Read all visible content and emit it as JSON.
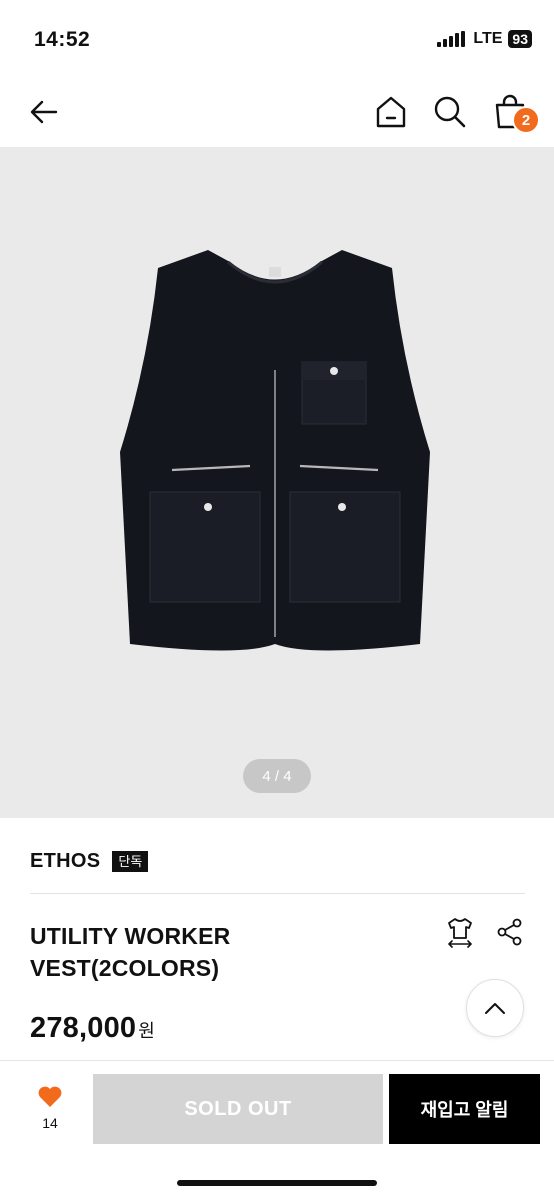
{
  "status_bar": {
    "time": "14:52",
    "network": "LTE",
    "battery": "93"
  },
  "nav": {
    "cart_count": "2",
    "icons": [
      "back-arrow-icon",
      "home-icon",
      "search-icon",
      "shopping-bag-icon"
    ]
  },
  "gallery": {
    "pager": "4 / 4",
    "image_alt": "black utility worker vest"
  },
  "product": {
    "brand": "ETHOS",
    "badge": "단독",
    "name_line1": "UTILITY WORKER",
    "name_line2": "VEST(2COLORS)",
    "price": "278,000",
    "currency": "원"
  },
  "bottom_bar": {
    "like_count": "14",
    "sold_out_label": "SOLD OUT",
    "restock_label": "재입고 알림"
  },
  "colors": {
    "accent": "#f26a1b",
    "primary": "#000000",
    "disabled": "#d4d4d4"
  }
}
